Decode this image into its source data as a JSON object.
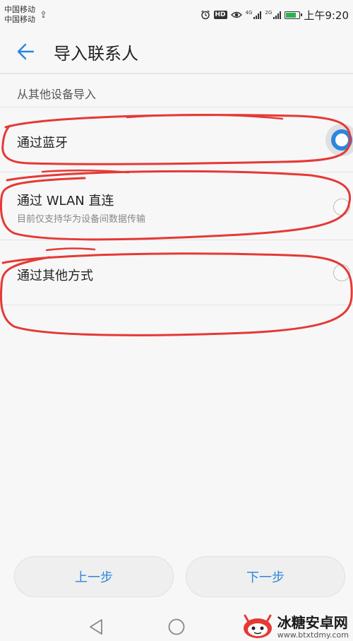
{
  "status_bar": {
    "carrier1": "中国移动",
    "carrier2": "中国移动",
    "usb_icon": "usb-icon",
    "hd_badge": "HD",
    "net1": "4G",
    "net2": "2G",
    "time": "上午9:20"
  },
  "header": {
    "back_icon": "arrow-left-icon",
    "title": "导入联系人"
  },
  "section": {
    "title": "从其他设备导入"
  },
  "options": [
    {
      "title": "通过蓝牙",
      "subtitle": "",
      "selected": true
    },
    {
      "title": "通过 WLAN 直连",
      "subtitle": "目前仅支持华为设备间数据传输",
      "selected": false
    },
    {
      "title": "通过其他方式",
      "subtitle": "",
      "selected": false
    }
  ],
  "buttons": {
    "prev": "上一步",
    "next": "下一步"
  },
  "nav": {
    "back_icon": "triangle-back-icon",
    "home_icon": "circle-home-icon",
    "recent_icon": "square-recent-icon"
  },
  "watermark": {
    "title": "冰糖安卓网",
    "url": "www.btxtdmy.com"
  },
  "colors": {
    "accent": "#2d86dd",
    "annotation": "#e53935"
  }
}
